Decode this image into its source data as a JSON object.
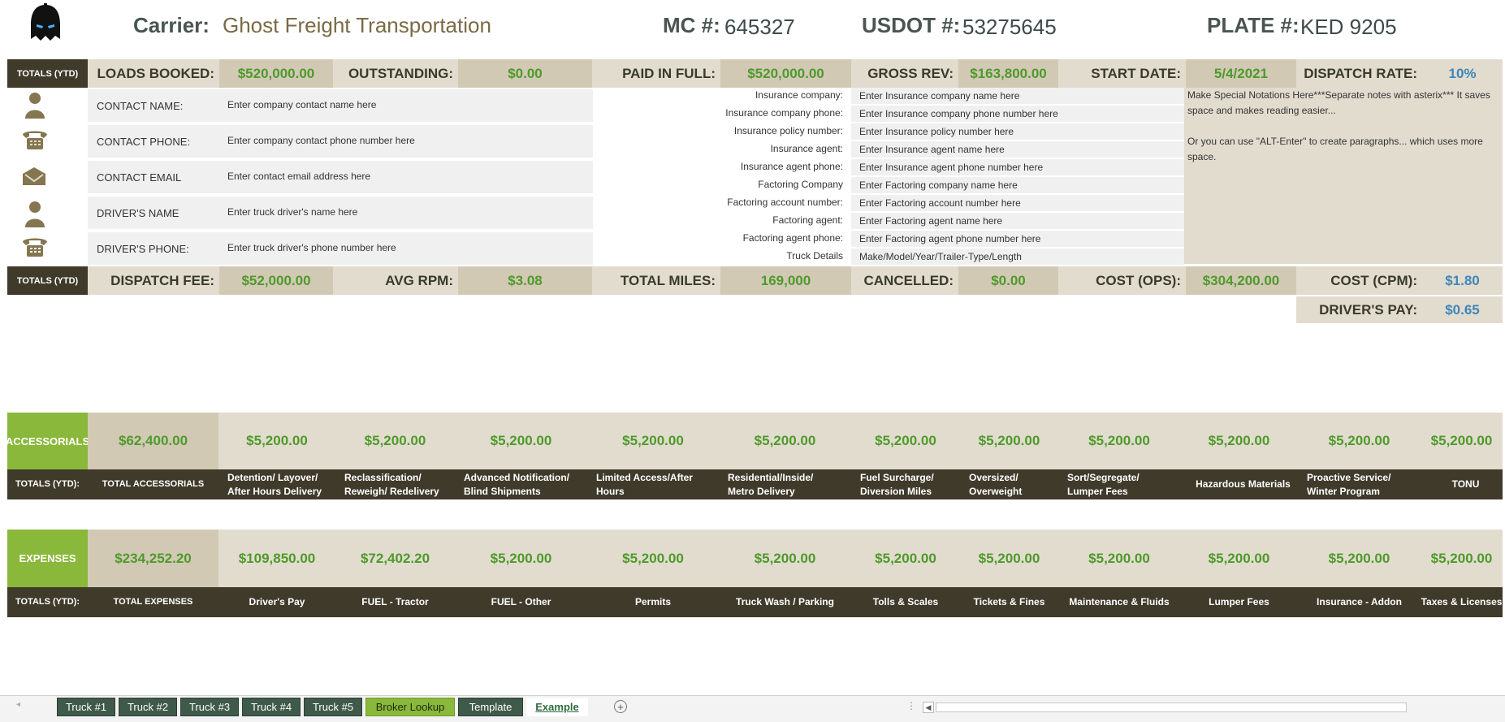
{
  "header": {
    "carrier_label": "Carrier:",
    "carrier_name": "Ghost Freight Transportation",
    "mc_label": "MC #:",
    "mc_value": "645327",
    "usdot_label": "USDOT #:",
    "usdot_value": "53275645",
    "plate_label": "PLATE #:",
    "plate_value": "KED 9205"
  },
  "totals_row1": {
    "tag": "TOTALS (YTD)",
    "items": [
      {
        "label": "LOADS BOOKED:",
        "value": "$520,000.00"
      },
      {
        "label": "OUTSTANDING:",
        "value": "$0.00"
      },
      {
        "label": "PAID IN FULL:",
        "value": "$520,000.00"
      },
      {
        "label": "GROSS REV:",
        "value": "$163,800.00"
      },
      {
        "label": "START DATE:",
        "value": "5/4/2021"
      },
      {
        "label": "DISPATCH RATE:",
        "value": "10%"
      }
    ]
  },
  "contacts": [
    {
      "icon": "person-icon",
      "label": "CONTACT NAME:",
      "value": "Enter company contact name here"
    },
    {
      "icon": "phone-icon",
      "label": "CONTACT PHONE:",
      "value": "Enter company contact phone number here"
    },
    {
      "icon": "envelope-icon",
      "label": "CONTACT EMAIL",
      "value": "Enter contact email address here"
    },
    {
      "icon": "person-icon",
      "label": "DRIVER'S NAME",
      "value": "Enter truck driver's name here"
    },
    {
      "icon": "phone-icon",
      "label": "DRIVER'S PHONE:",
      "value": "Enter truck driver's phone number here"
    }
  ],
  "insurance": [
    {
      "label": "Insurance company:",
      "value": "Enter Insurance company name here"
    },
    {
      "label": "Insurance company phone:",
      "value": "Enter Insurance company phone number here"
    },
    {
      "label": "Insurance policy number:",
      "value": "Enter Insurance policy number here"
    },
    {
      "label": "Insurance agent:",
      "value": "Enter Insurance agent name here"
    },
    {
      "label": "Insurance agent phone:",
      "value": "Enter Insurance agent phone number here"
    },
    {
      "label": "Factoring Company",
      "value": "Enter Factoring company name here"
    },
    {
      "label": "Factoring account number:",
      "value": "Enter Factoring account number here"
    },
    {
      "label": "Factoring agent:",
      "value": "Enter Factoring agent name here"
    },
    {
      "label": "Factoring agent phone:",
      "value": "Enter Factoring agent phone number here"
    },
    {
      "label": "Truck  Details",
      "value": "Make/Model/Year/Trailer-Type/Length"
    }
  ],
  "notes": {
    "line1": "Make Special Notations Here***Separate notes with asterix*** It saves space and makes reading easier...",
    "line2": "Or you can use \"ALT-Enter\" to create paragraphs... which uses more space."
  },
  "totals_row2": {
    "tag": "TOTALS (YTD)",
    "items": [
      {
        "label": "DISPATCH FEE:",
        "value": "$52,000.00"
      },
      {
        "label": "AVG RPM:",
        "value": "$3.08"
      },
      {
        "label": "TOTAL MILES:",
        "value": "169,000"
      },
      {
        "label": "CANCELLED:",
        "value": "$0.00"
      },
      {
        "label": "COST (OPS):",
        "value": "$304,200.00"
      },
      {
        "label": "COST (CPM):",
        "value": "$1.80"
      }
    ],
    "drivers_pay_label": "DRIVER'S PAY:",
    "drivers_pay_value": "$0.65"
  },
  "accessorials": {
    "tag": "ACCESSORIALS",
    "totals_tag": "TOTALS (YTD):",
    "total_value": "$62,400.00",
    "total_label": "TOTAL ACCESSORIALS",
    "items": [
      {
        "value": "$5,200.00",
        "label1": "Detention/ Layover/",
        "label2": "After Hours Delivery"
      },
      {
        "value": "$5,200.00",
        "label1": "Reclassification/",
        "label2": "Reweigh/ Redelivery"
      },
      {
        "value": "$5,200.00",
        "label1": "Advanced Notification/",
        "label2": "Blind Shipments"
      },
      {
        "value": "$5,200.00",
        "label1": "Limited Access/After",
        "label2": "Hours"
      },
      {
        "value": "$5,200.00",
        "label1": "Residential/Inside/",
        "label2": "Metro Delivery"
      },
      {
        "value": "$5,200.00",
        "label1": "Fuel Surcharge/",
        "label2": "Diversion Miles"
      },
      {
        "value": "$5,200.00",
        "label1": "Oversized/",
        "label2": "Overweight"
      },
      {
        "value": "$5,200.00",
        "label1": "Sort/Segregate/",
        "label2": "Lumper Fees"
      },
      {
        "value": "$5,200.00",
        "label1": "Hazardous Materials",
        "label2": ""
      },
      {
        "value": "$5,200.00",
        "label1": "Proactive Service/",
        "label2": "Winter Program"
      },
      {
        "value": "$5,200.00",
        "label1": "TONU",
        "label2": ""
      }
    ]
  },
  "expenses": {
    "tag": "EXPENSES",
    "totals_tag": "TOTALS (YTD):",
    "total_value": "$234,252.20",
    "total_label": "TOTAL EXPENSES",
    "items": [
      {
        "value": "$109,850.00",
        "label": "Driver's Pay"
      },
      {
        "value": "$72,402.20",
        "label": "FUEL - Tractor"
      },
      {
        "value": "$5,200.00",
        "label": "FUEL - Other"
      },
      {
        "value": "$5,200.00",
        "label": "Permits"
      },
      {
        "value": "$5,200.00",
        "label": "Truck Wash / Parking"
      },
      {
        "value": "$5,200.00",
        "label": "Tolls & Scales"
      },
      {
        "value": "$5,200.00",
        "label": "Tickets & Fines"
      },
      {
        "value": "$5,200.00",
        "label": "Maintenance & Fluids"
      },
      {
        "value": "$5,200.00",
        "label": "Lumper Fees"
      },
      {
        "value": "$5,200.00",
        "label": "Insurance - Addon"
      },
      {
        "value": "$5,200.00",
        "label": "Taxes & Licenses"
      }
    ]
  },
  "sheet_tabs": [
    {
      "label": "Truck #1",
      "active": false
    },
    {
      "label": "Truck #2",
      "active": false
    },
    {
      "label": "Truck #3",
      "active": false
    },
    {
      "label": "Truck #4",
      "active": false
    },
    {
      "label": "Truck #5",
      "active": false
    },
    {
      "label": "Broker Lookup",
      "active": false
    },
    {
      "label": "Template",
      "active": false
    },
    {
      "label": "Example",
      "active": true
    }
  ],
  "colors": {
    "dark": "#3f3a2a",
    "tan": "#e2dccf",
    "green_accent": "#8ab83a",
    "value_green": "#4e9a2a",
    "value_blue": "#3e86b8"
  }
}
